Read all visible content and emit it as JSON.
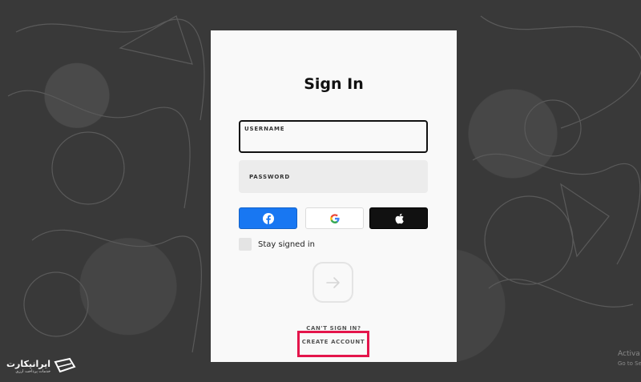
{
  "panel": {
    "title": "Sign In",
    "username_label": "USERNAME",
    "password_label": "PASSWORD",
    "social": [
      {
        "provider": "Facebook",
        "icon": "facebook-icon",
        "color": "#1877f2"
      },
      {
        "provider": "Google",
        "icon": "google-icon",
        "color": "#ffffff"
      },
      {
        "provider": "Apple",
        "icon": "apple-icon",
        "color": "#111111"
      }
    ],
    "stay_signed_in": "Stay signed in",
    "stay_signed_in_checked": false,
    "submit_icon": "arrow-right-icon",
    "cant_sign_in": "CAN'T SIGN IN?",
    "create_account": "CREATE ACCOUNT",
    "highlight_color": "#e4154b"
  },
  "watermark": {
    "title": "ایرانیکارت",
    "subtitle": "خدمات پرداخت ارزی"
  },
  "os_notice": {
    "line1": "Activa",
    "line2": "Go to Se"
  }
}
